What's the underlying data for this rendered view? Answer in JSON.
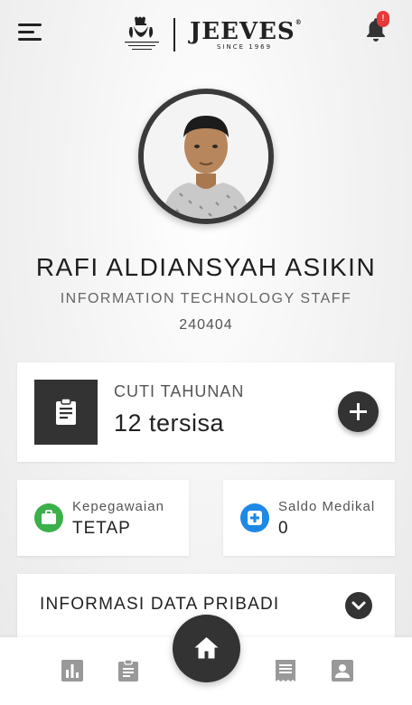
{
  "header": {
    "brand": "JEEVES",
    "brand_mark": "®",
    "tagline": "SINCE 1969",
    "crest_text": "BY APPOINTMENT TO H.R.H. THE PRINCE OF WALES DRY CLEANERS",
    "notification_count": "!"
  },
  "profile": {
    "name": "RAFI ALDIANSYAH ASIKIN",
    "job_title": "INFORMATION TECHNOLOGY STAFF",
    "employee_id": "240404"
  },
  "leave_card": {
    "title": "CUTI TAHUNAN",
    "remaining": "12 tersisa"
  },
  "employment_card": {
    "label": "Kepegawaian",
    "value": "TETAP",
    "icon": "briefcase-icon",
    "color": "#3cb04a"
  },
  "medical_card": {
    "label": "Saldo Medikal",
    "value": "0",
    "icon": "medical-cross-icon",
    "color": "#1e88e5"
  },
  "personal_info": {
    "title": "INFORMASI DATA PRIBADI"
  },
  "bottom_nav": {
    "items": [
      "chart-icon",
      "clipboard-icon",
      "home-icon",
      "receipt-icon",
      "contact-icon"
    ],
    "active": "home-icon"
  },
  "colors": {
    "dark": "#333333",
    "badge": "#e53a3a",
    "nav_icon": "#999999"
  }
}
